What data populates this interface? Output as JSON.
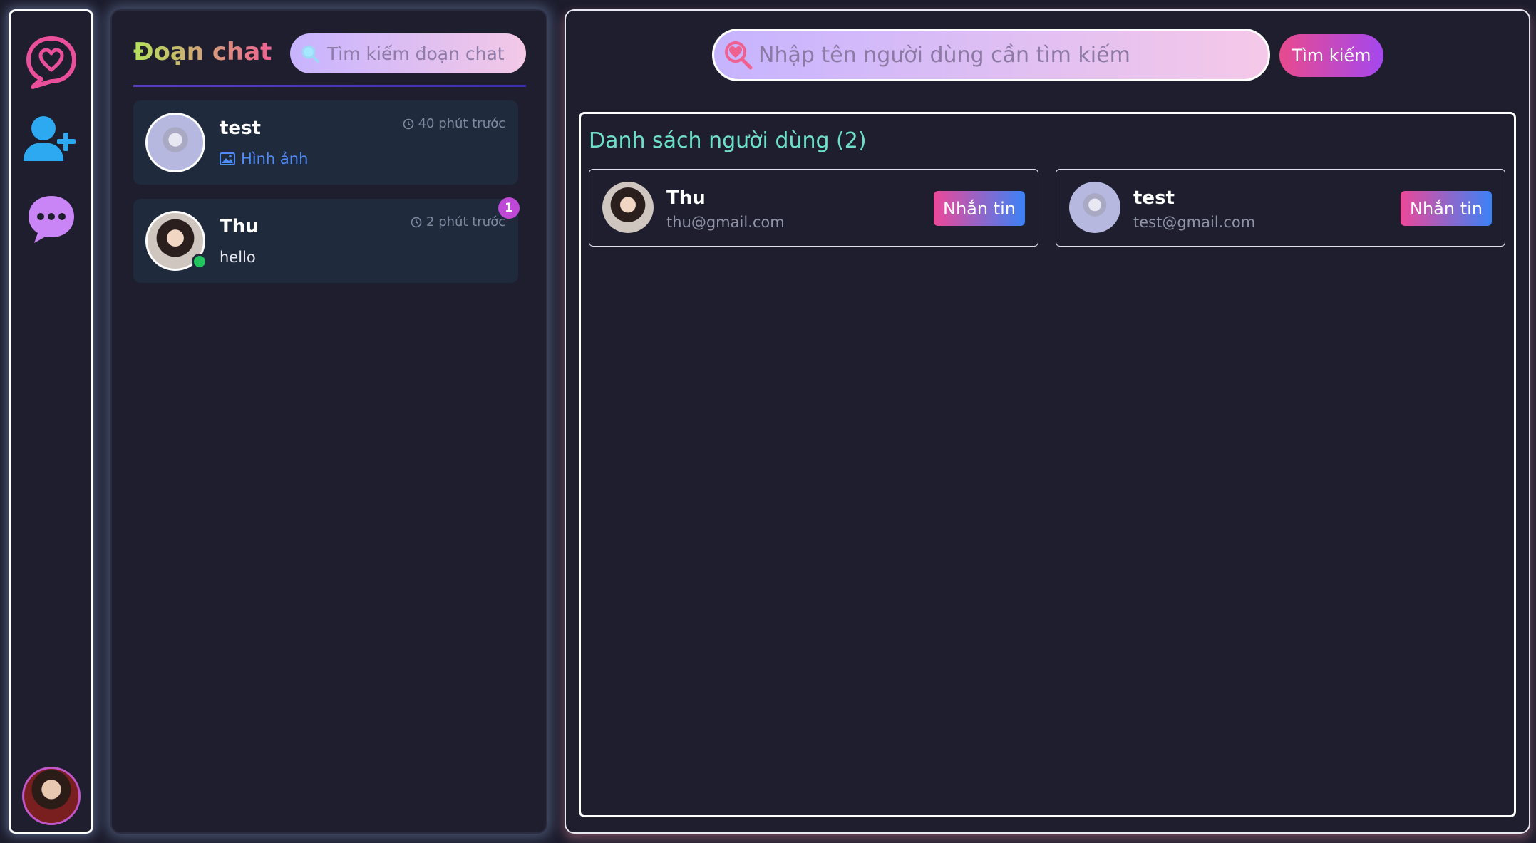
{
  "rail": {
    "logo_icon": "chat-heart-icon",
    "add_friend_icon": "user-plus-icon",
    "chat_icon": "chat-dots-icon",
    "accent": "#e94f9a",
    "blue": "#2ca9f0",
    "purple": "#c984f5"
  },
  "chats": {
    "title": "Đoạn chat",
    "search_placeholder": "Tìm kiếm đoạn chat",
    "items": [
      {
        "name": "test",
        "time": "40 phút trước",
        "preview": "Hình ảnh",
        "preview_icon": "image-icon",
        "unread": ""
      },
      {
        "name": "Thu",
        "time": "2 phút trước",
        "preview": "hello",
        "unread": "1",
        "online": true
      }
    ]
  },
  "main": {
    "search_placeholder": "Nhập tên người dùng cần tìm kiếm",
    "search_button": "Tìm kiếm",
    "list_title": "Danh sách người dùng (2)",
    "users": [
      {
        "name": "Thu",
        "email": "thu@gmail.com",
        "button": "Nhắn tin"
      },
      {
        "name": "test",
        "email": "test@gmail.com",
        "button": "Nhắn tin"
      }
    ]
  }
}
